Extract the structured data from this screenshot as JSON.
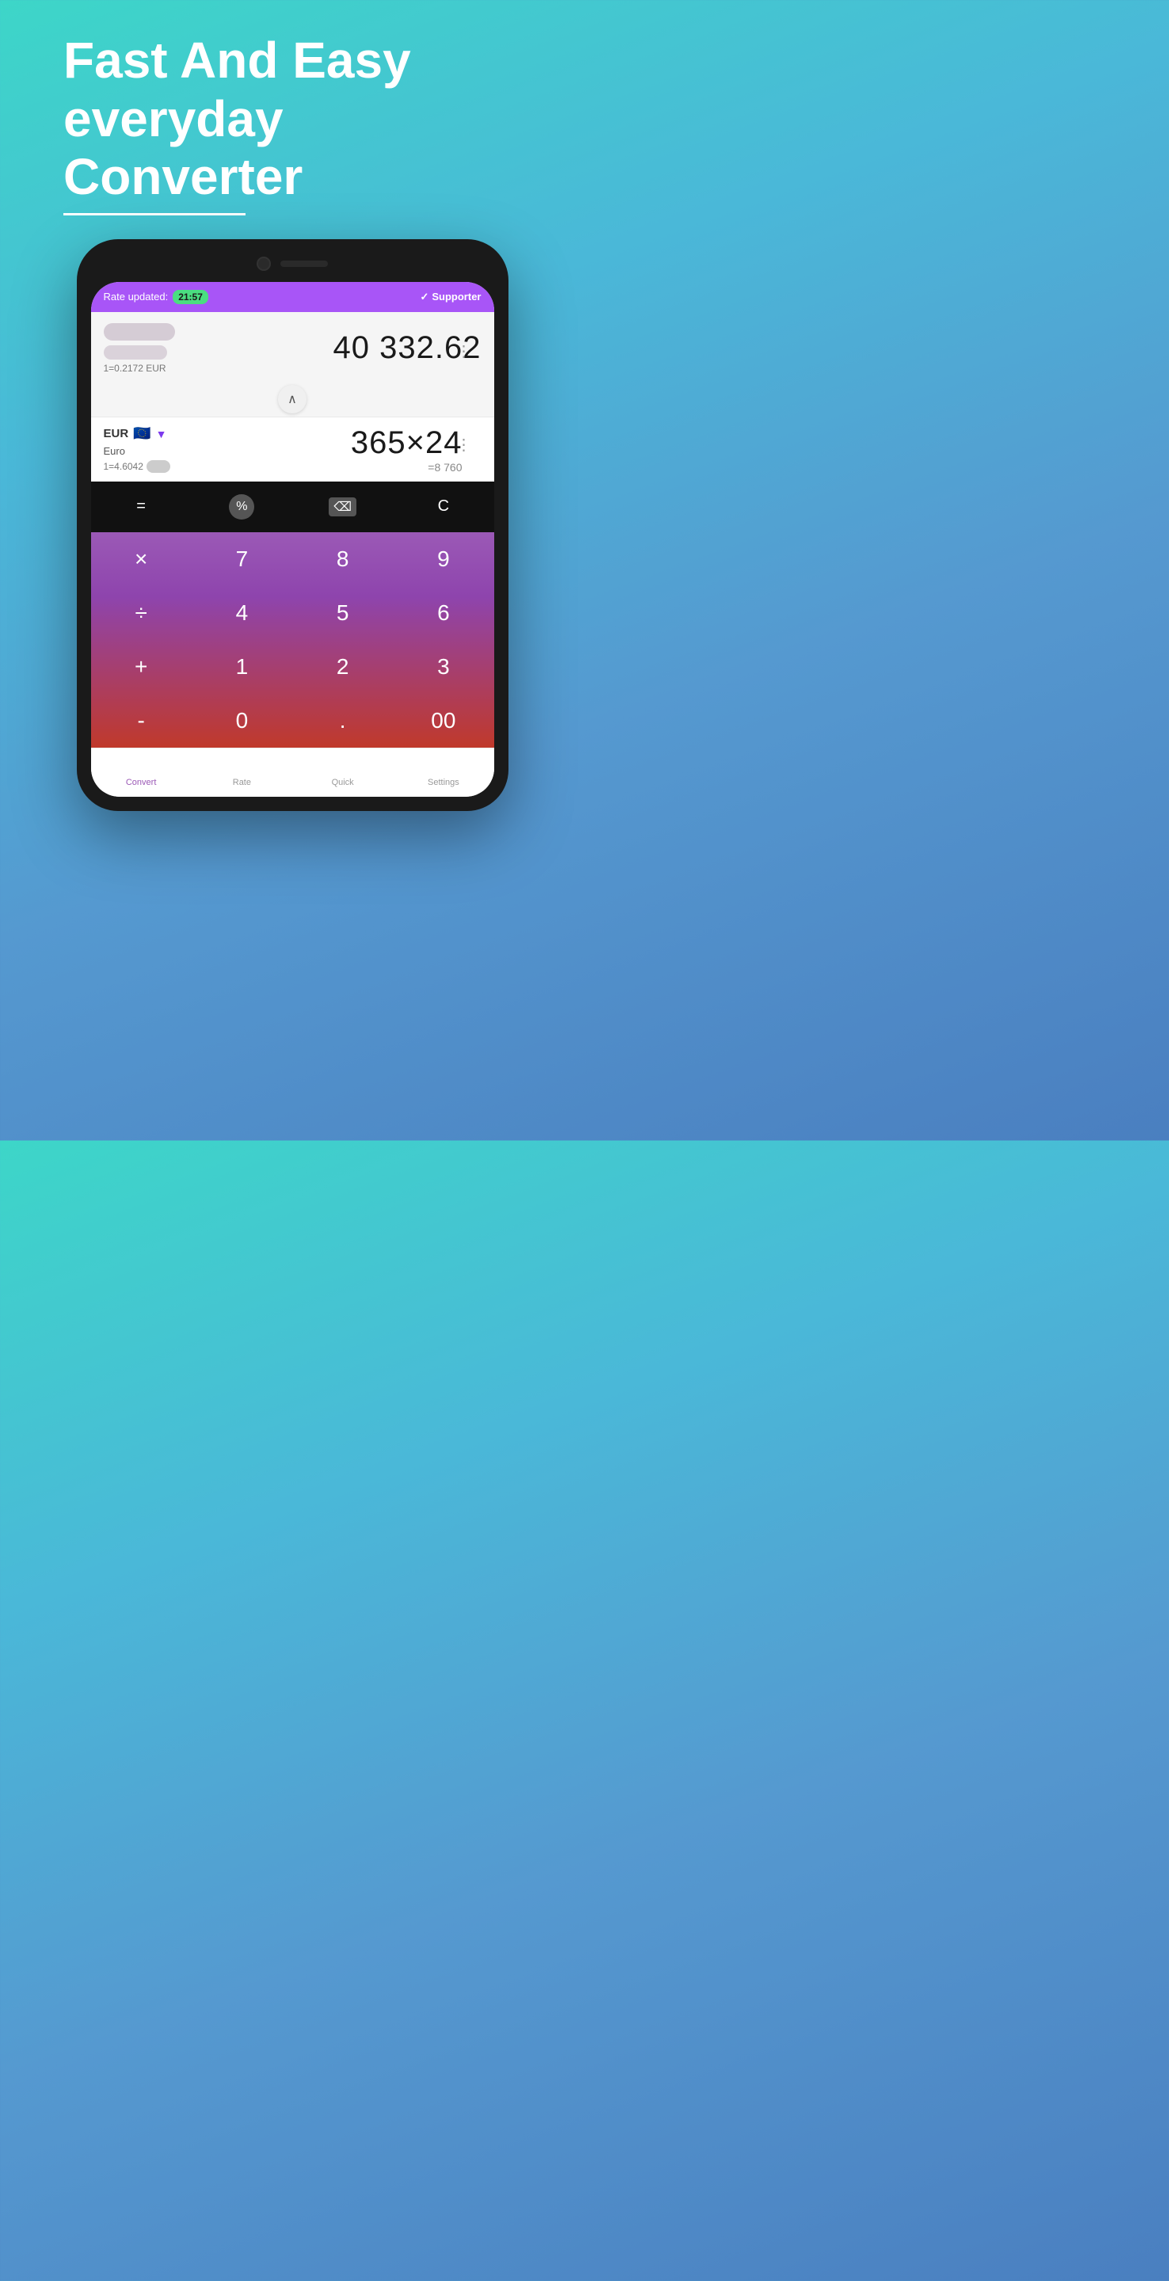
{
  "hero": {
    "line1": "Fast And Easy",
    "line2": "everyday",
    "line3": "Converter"
  },
  "app": {
    "header": {
      "rate_label": "Rate updated:",
      "rate_time": "21:57",
      "supporter_label": "Supporter"
    },
    "row1": {
      "value": "40 332.62",
      "rate": "1=0.2172 EUR"
    },
    "row2": {
      "code": "EUR",
      "name": "Euro",
      "rate_prefix": "1=4.6042",
      "value": "365×24",
      "subvalue": "=8 760"
    },
    "keypad_top": {
      "equals": "=",
      "percent": "%",
      "backspace": "⌫",
      "clear": "C"
    },
    "keypad": {
      "keys": [
        "×",
        "7",
        "8",
        "9",
        "÷",
        "4",
        "5",
        "6",
        "+",
        "1",
        "2",
        "3",
        "-",
        "0",
        ".",
        "00"
      ]
    },
    "nav": {
      "items": [
        {
          "label": "Convert",
          "active": true
        },
        {
          "label": "Rate",
          "active": false
        },
        {
          "label": "Quick",
          "active": false
        },
        {
          "label": "Settings",
          "active": false
        }
      ]
    }
  }
}
